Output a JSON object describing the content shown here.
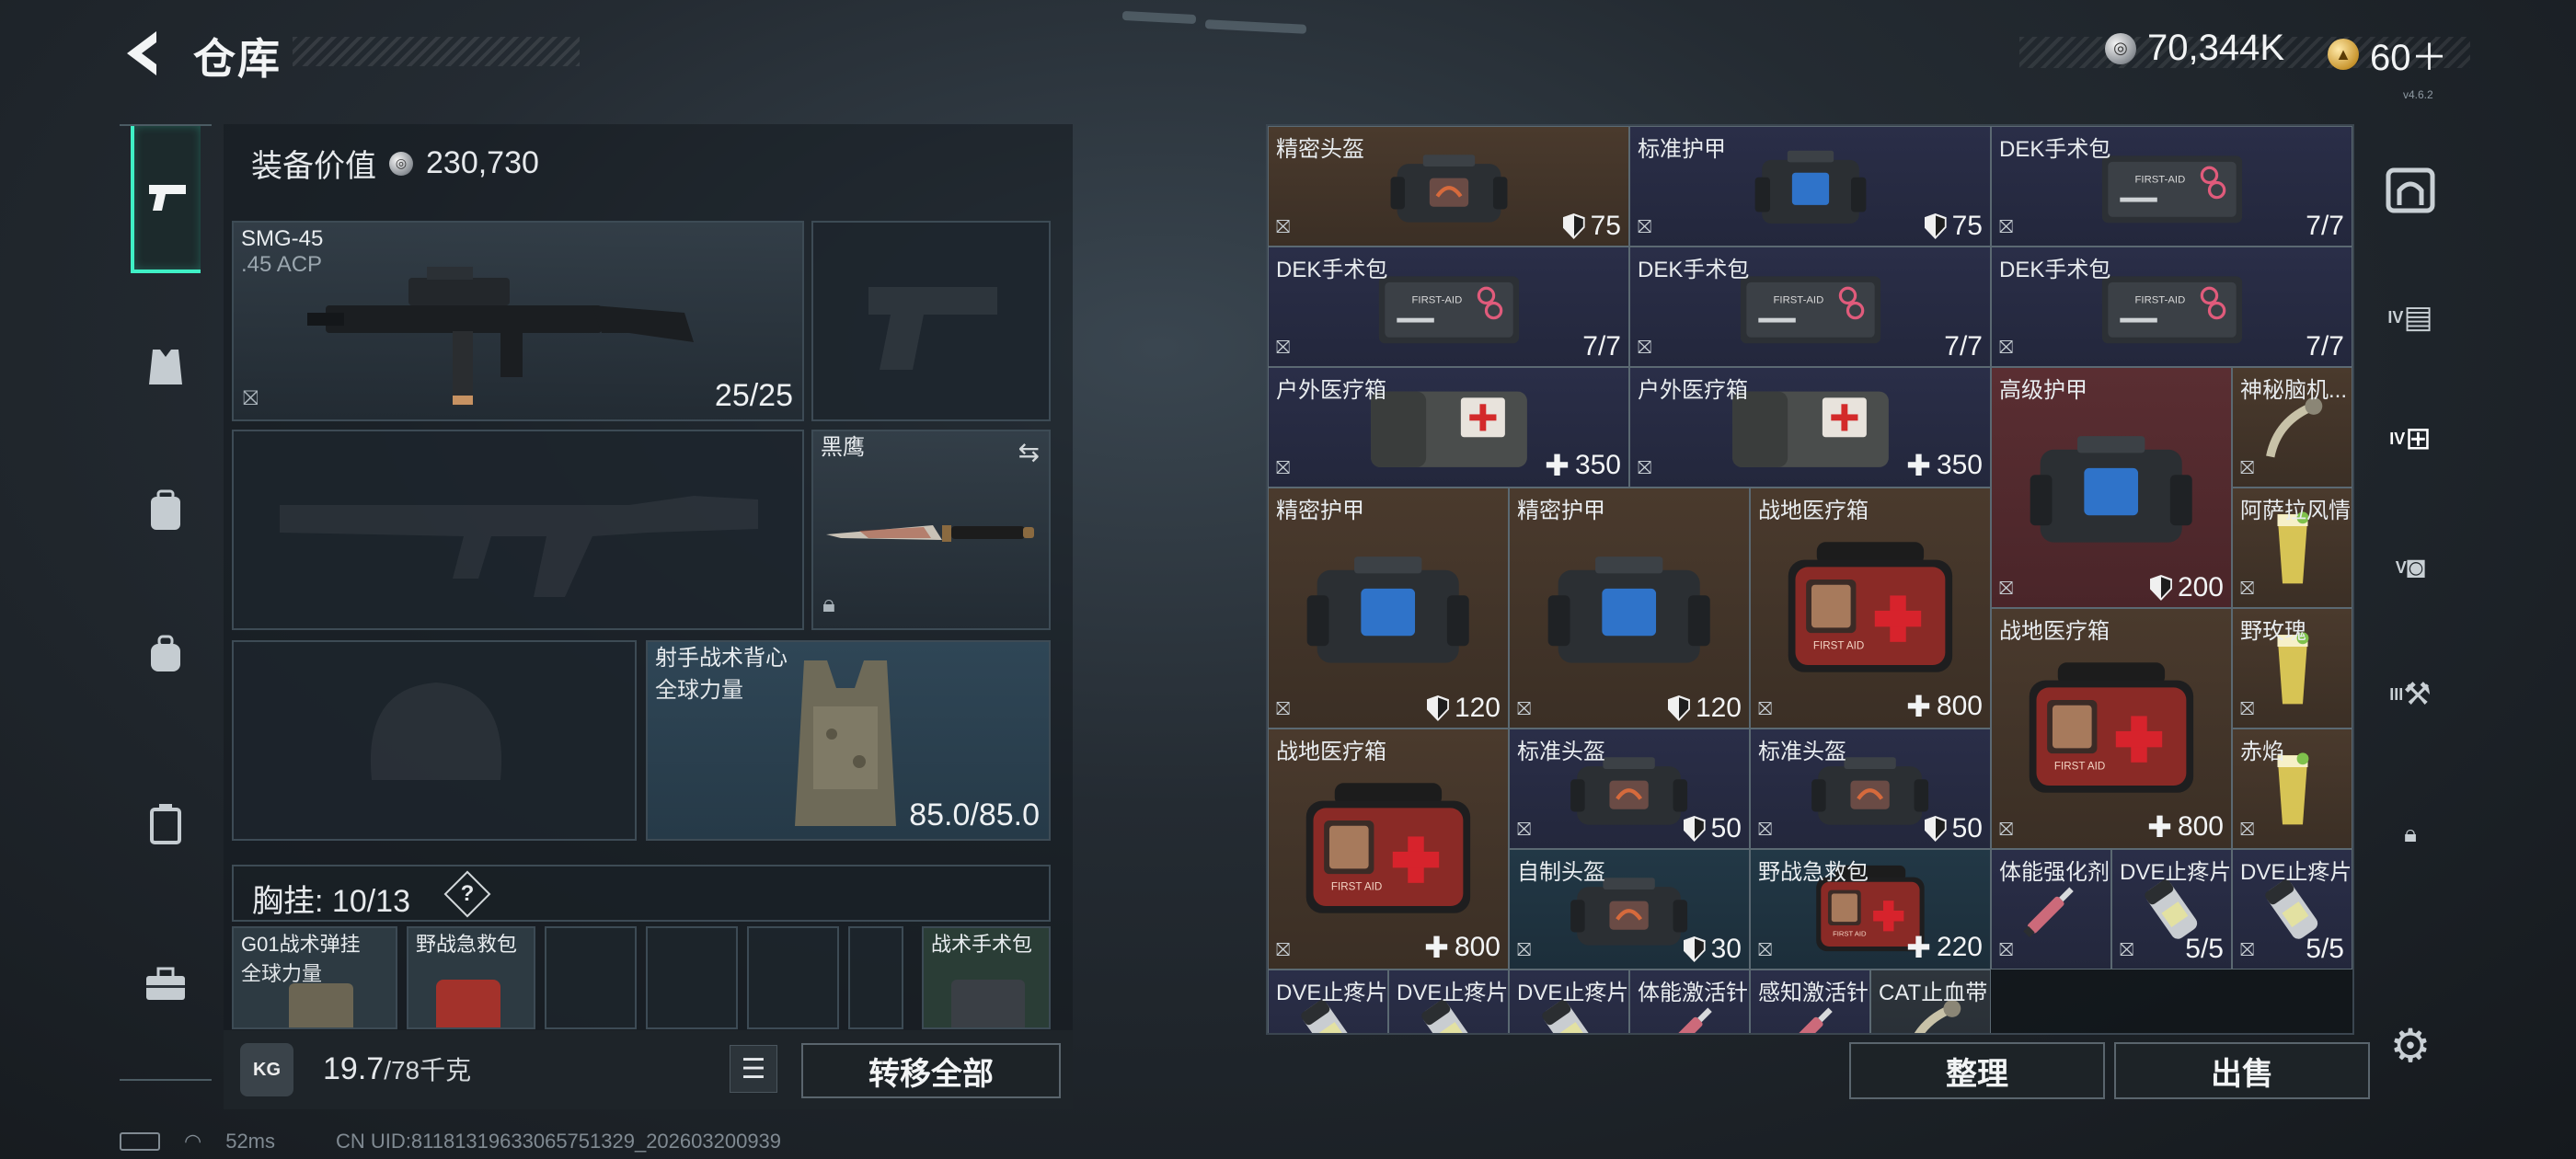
{
  "header": {
    "title": "仓库"
  },
  "currency": {
    "silver": "70,344K",
    "gold": "60＋",
    "version": "v4.6.2"
  },
  "equipment": {
    "value_label": "装备价值",
    "value": "230,730",
    "primary": {
      "name": "SMG-45",
      "caliber": ".45 ACP",
      "ammo": "25/25"
    },
    "melee": {
      "name": "黑鹰"
    },
    "armor": {
      "name": "射手战术背心",
      "sub": "全球力量",
      "durability": "85.0/85.0"
    },
    "chest_rig": {
      "label": "胸挂:",
      "value": "10/13",
      "help": "?"
    },
    "pockets": [
      {
        "name": "G01战术弹挂",
        "sub": "全球力量"
      },
      {
        "name": "野战急救包"
      },
      {
        "name": "战术手术包"
      }
    ],
    "weight": {
      "current": "19.7",
      "max": "/78千克",
      "badge": "KG"
    },
    "transfer_all": "转移全部"
  },
  "inventory": {
    "items": [
      {
        "name": "精密头盔",
        "value": "75",
        "icon": "shield",
        "color": "brown",
        "art": "helmet"
      },
      {
        "name": "标准护甲",
        "value": "75",
        "icon": "shield",
        "color": "navy",
        "art": "armor"
      },
      {
        "name": "DEK手术包",
        "value": "7/7",
        "icon": "",
        "color": "navy",
        "art": "kit"
      },
      {
        "name": "DEK手术包",
        "value": "7/7",
        "icon": "",
        "color": "navy",
        "art": "kit"
      },
      {
        "name": "DEK手术包",
        "value": "7/7",
        "icon": "",
        "color": "navy",
        "art": "kit"
      },
      {
        "name": "DEK手术包",
        "value": "7/7",
        "icon": "",
        "color": "navy",
        "art": "kit"
      },
      {
        "name": "户外医疗箱",
        "value": "350",
        "icon": "plus",
        "color": "navy",
        "art": "box"
      },
      {
        "name": "户外医疗箱",
        "value": "350",
        "icon": "plus",
        "color": "navy",
        "art": "box"
      },
      {
        "name": "高级护甲",
        "value": "200",
        "icon": "shield",
        "color": "red",
        "art": "armor"
      },
      {
        "name": "神秘脑机...",
        "value": "",
        "icon": "",
        "color": "brown",
        "art": "misc"
      },
      {
        "name": "精密护甲",
        "value": "120",
        "icon": "shield",
        "color": "brown",
        "art": "armor"
      },
      {
        "name": "精密护甲",
        "value": "120",
        "icon": "shield",
        "color": "brown",
        "art": "armor"
      },
      {
        "name": "战地医疗箱",
        "value": "800",
        "icon": "plus",
        "color": "brown",
        "art": "aid"
      },
      {
        "name": "阿萨拉风情",
        "value": "",
        "icon": "",
        "color": "brown",
        "art": "drink"
      },
      {
        "name": "战地医疗箱",
        "value": "800",
        "icon": "plus",
        "color": "brown",
        "art": "aid"
      },
      {
        "name": "野玫瑰",
        "value": "",
        "icon": "",
        "color": "brown",
        "art": "drink"
      },
      {
        "name": "战地医疗箱",
        "value": "800",
        "icon": "plus",
        "color": "brown",
        "art": "aid"
      },
      {
        "name": "标准头盔",
        "value": "50",
        "icon": "shield",
        "color": "navy",
        "art": "helmet"
      },
      {
        "name": "标准头盔",
        "value": "50",
        "icon": "shield",
        "color": "navy",
        "art": "helmet"
      },
      {
        "name": "赤焰",
        "value": "",
        "icon": "",
        "color": "brown",
        "art": "drink"
      },
      {
        "name": "自制头盔",
        "value": "30",
        "icon": "shield",
        "color": "teal",
        "art": "helmet"
      },
      {
        "name": "野战急救包",
        "value": "220",
        "icon": "plus",
        "color": "teal",
        "art": "aid"
      },
      {
        "name": "体能强化剂",
        "value": "",
        "icon": "",
        "color": "navy",
        "art": "syringe"
      },
      {
        "name": "DVE止疼片",
        "value": "5/5",
        "icon": "",
        "color": "navy",
        "art": "pill"
      },
      {
        "name": "DVE止疼片",
        "value": "5/5",
        "icon": "",
        "color": "navy",
        "art": "pill"
      },
      {
        "name": "DVE止疼片",
        "value": "",
        "icon": "",
        "color": "navy",
        "art": "pill"
      },
      {
        "name": "DVE止疼片",
        "value": "",
        "icon": "",
        "color": "navy",
        "art": "pill"
      },
      {
        "name": "DVE止疼片",
        "value": "",
        "icon": "",
        "color": "navy",
        "art": "pill"
      },
      {
        "name": "体能激活针",
        "value": "",
        "icon": "",
        "color": "navy",
        "art": "syringe"
      },
      {
        "name": "感知激活针",
        "value": "",
        "icon": "",
        "color": "navy",
        "art": "syringe"
      },
      {
        "name": "CAT止血带",
        "value": "",
        "icon": "",
        "color": "gray",
        "art": "misc"
      }
    ],
    "sort_button": "整理",
    "sell_button": "出售"
  },
  "status": {
    "ping": "52ms",
    "uid": "CN UID:81181319633065751329_202603200939"
  },
  "right_tabs": [
    "IV",
    "IV",
    "V",
    "III"
  ]
}
